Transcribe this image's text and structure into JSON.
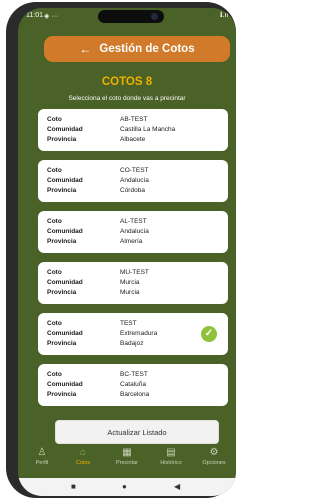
{
  "status_bar": {
    "time": "11:01",
    "left_icons": "◈ ···",
    "right_icons": "ℹ.ıl"
  },
  "header": {
    "title": "Gestión de Cotos",
    "back_icon": "arrow-left-icon"
  },
  "page": {
    "title": "COTOS 8",
    "subtitle": "Selecciona el coto donde vas a precintar"
  },
  "labels": {
    "coto": "Coto",
    "comunidad": "Comunidad",
    "provincia": "Provincia"
  },
  "cotos": [
    {
      "coto": "AB-TEST",
      "comunidad": "Castilla La Mancha",
      "provincia": "Albacete",
      "selected": false
    },
    {
      "coto": "CO-TEST",
      "comunidad": "Andalucía",
      "provincia": "Córdoba",
      "selected": false
    },
    {
      "coto": "AL-TEST",
      "comunidad": "Andalucía",
      "provincia": "Almería",
      "selected": false
    },
    {
      "coto": "MU-TEST",
      "comunidad": "Murcia",
      "provincia": "Murcia",
      "selected": false
    },
    {
      "coto": "TEST",
      "comunidad": "Extremadura",
      "provincia": "Badajoz",
      "selected": true
    },
    {
      "coto": "BC-TEST",
      "comunidad": "Cataluña",
      "provincia": "Barcelona",
      "selected": false
    }
  ],
  "refresh_button": {
    "label": "Actualizar Listado"
  },
  "nav": [
    {
      "label": "Perfil",
      "icon": "person-icon",
      "active": false
    },
    {
      "label": "Cotos",
      "icon": "home-icon",
      "active": true
    },
    {
      "label": "Precintar",
      "icon": "qr-code-icon",
      "active": false
    },
    {
      "label": "Histórico",
      "icon": "history-icon",
      "active": false
    },
    {
      "label": "Opciones",
      "icon": "gear-icon",
      "active": false
    }
  ],
  "colors": {
    "background": "#4a6127",
    "header": "#d17a2a",
    "accent": "#f0b000",
    "check": "#8dc23a"
  }
}
